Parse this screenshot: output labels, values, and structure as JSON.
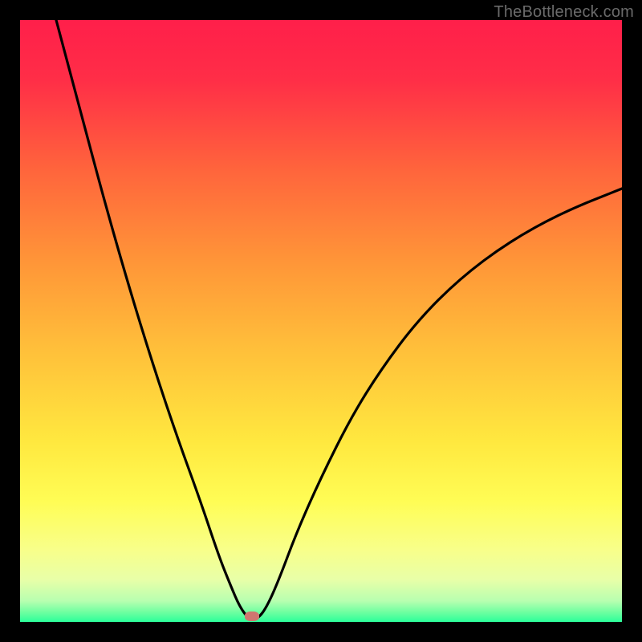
{
  "watermark": "TheBottleneck.com",
  "marker": {
    "x_pct": 38.5,
    "y_pct": 99.0
  },
  "gradient_stops": [
    {
      "offset": 0.0,
      "color": "#ff1f4a"
    },
    {
      "offset": 0.1,
      "color": "#ff2e47"
    },
    {
      "offset": 0.25,
      "color": "#ff653c"
    },
    {
      "offset": 0.4,
      "color": "#ff9538"
    },
    {
      "offset": 0.55,
      "color": "#ffc03a"
    },
    {
      "offset": 0.7,
      "color": "#ffe83f"
    },
    {
      "offset": 0.8,
      "color": "#fffd55"
    },
    {
      "offset": 0.88,
      "color": "#f8ff8a"
    },
    {
      "offset": 0.93,
      "color": "#e8ffa8"
    },
    {
      "offset": 0.965,
      "color": "#b8ffb0"
    },
    {
      "offset": 0.985,
      "color": "#6affa0"
    },
    {
      "offset": 1.0,
      "color": "#2bff9a"
    }
  ],
  "chart_data": {
    "type": "line",
    "title": "",
    "xlabel": "",
    "ylabel": "",
    "xrange": [
      0,
      100
    ],
    "yrange": [
      0,
      100
    ],
    "note": "V-shaped bottleneck curve. y≈100 means high bottleneck (top, red), y≈0 means no bottleneck (bottom, green). Minimum around x≈38.",
    "series": [
      {
        "name": "bottleneck-curve",
        "x": [
          6,
          10,
          14,
          18,
          22,
          26,
          30,
          33,
          35,
          36.5,
          38,
          39.5,
          41,
          43,
          46,
          50,
          55,
          60,
          66,
          73,
          81,
          90,
          100
        ],
        "y": [
          100,
          85,
          70,
          56,
          43,
          31,
          20,
          11,
          6,
          2.5,
          0.5,
          0.5,
          2.5,
          7,
          15,
          24,
          34,
          42,
          50,
          57,
          63,
          68,
          72
        ]
      }
    ],
    "marker_point": {
      "x": 38.5,
      "y": 0.8
    }
  }
}
